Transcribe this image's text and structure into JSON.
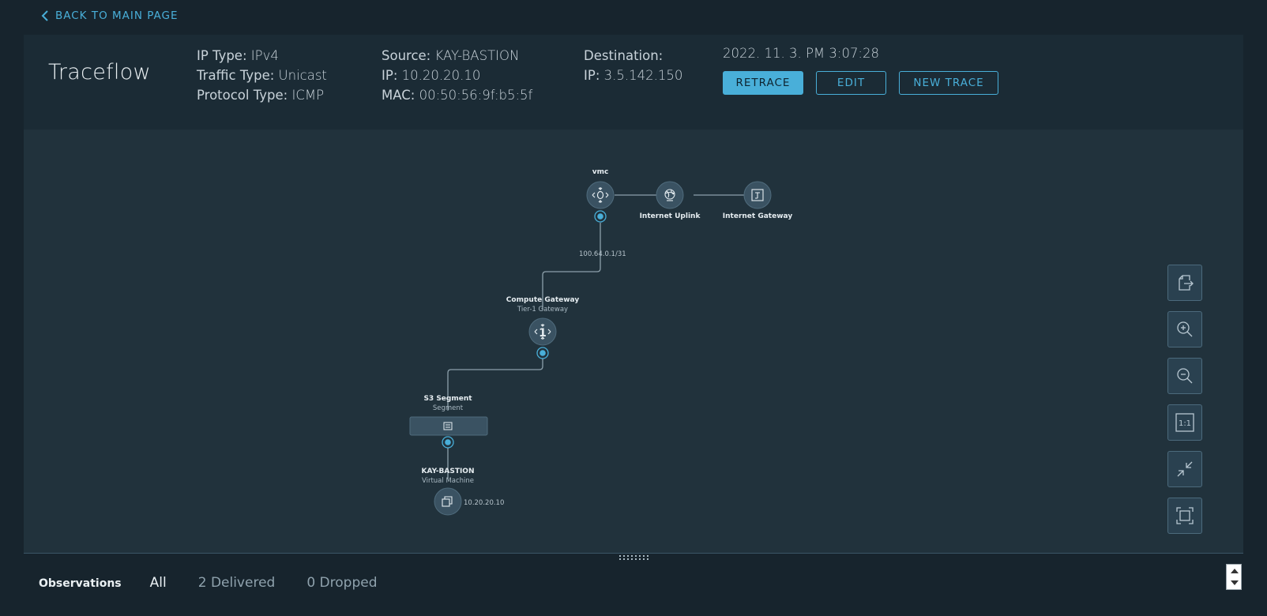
{
  "nav": {
    "back_label": "BACK TO MAIN PAGE"
  },
  "header": {
    "title": "Traceflow",
    "ip_type_label": "IP Type:",
    "ip_type": "IPv4",
    "traffic_type_label": "Traffic Type:",
    "traffic_type": "Unicast",
    "protocol_type_label": "Protocol Type:",
    "protocol_type": "ICMP",
    "source_label": "Source:",
    "source": "KAY-BASTION",
    "source_ip_label": "IP:",
    "source_ip": "10.20.20.10",
    "source_mac_label": "MAC:",
    "source_mac": "00:50:56:9f:b5:5f",
    "destination_label": "Destination:",
    "destination_ip_label": "IP:",
    "destination_ip": "3.5.142.150",
    "timestamp": "2022. 11. 3. PM 3:07:28",
    "buttons": {
      "retrace": "RETRACE",
      "edit": "EDIT",
      "new_trace": "NEW TRACE"
    }
  },
  "topology": {
    "nodes": {
      "vmc": {
        "label": "vmc"
      },
      "internet_uplink": {
        "label": "Internet Uplink"
      },
      "internet_gateway": {
        "label": "Internet Gateway"
      },
      "compute_gateway": {
        "label": "Compute Gateway",
        "sublabel": "Tier-1 Gateway",
        "badge": "1"
      },
      "s3_segment": {
        "label": "S3 Segment",
        "sublabel": "Segment"
      },
      "kay_bastion": {
        "label": "KAY-BASTION",
        "sublabel": "Virtual Machine",
        "ip": "10.20.20.10"
      }
    },
    "edges": {
      "vmc_to_compute": "100.64.0.1/31"
    }
  },
  "toolbar": [
    "export-icon",
    "zoom-in-icon",
    "zoom-out-icon",
    "actual-size-icon",
    "collapse-icon",
    "fit-to-screen-icon"
  ],
  "observations": {
    "title": "Observations",
    "tabs": {
      "all": "All",
      "delivered": "2 Delivered",
      "dropped": "0 Dropped"
    }
  },
  "colors": {
    "accent": "#49afd9",
    "background": "#17242d",
    "panel": "#1b2b35",
    "canvas": "#21323c"
  }
}
